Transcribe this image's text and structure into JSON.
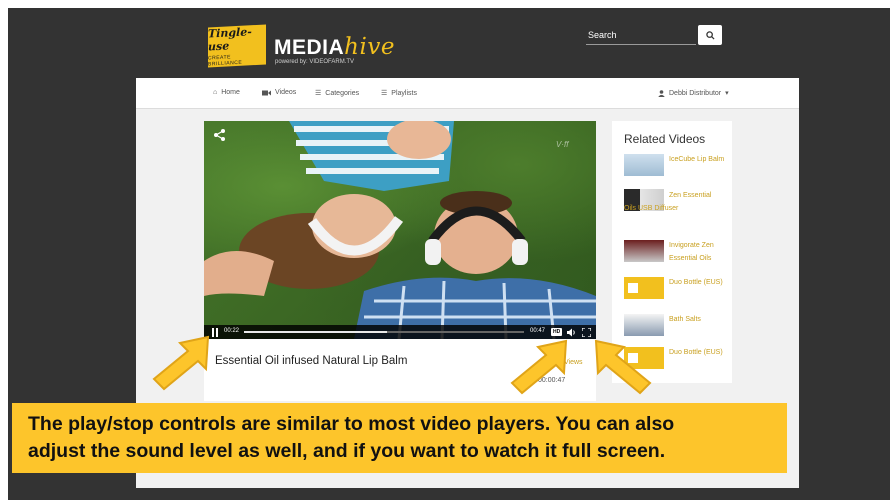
{
  "header": {
    "brand_badge_text": "Tingle-use",
    "brand_badge_subtext": "CREATE BRILLIANCE",
    "brand_word_main": "MEDIA",
    "brand_word_accent": "hive",
    "brand_powered": "powered by: VIDEOFARM.TV",
    "search_label": "Search",
    "search_icon": "search-icon"
  },
  "nav": {
    "home": "Home",
    "videos": "Videos",
    "categories": "Categories",
    "playlists": "Playlists",
    "user": "Debbi Distributor",
    "user_caret": "▾"
  },
  "player": {
    "current_time": "00:22",
    "total_time": "00:47",
    "progress": 0.51,
    "hd_label": "HD",
    "watermark": "V·ff",
    "icons": [
      "share-icon",
      "pause-icon",
      "volume-icon",
      "fullscreen-icon"
    ]
  },
  "video_info": {
    "title": "Essential Oil infused Natural Lip Balm",
    "views": "Views",
    "duration": "00:00:47"
  },
  "related": {
    "title": "Related Videos",
    "items": [
      {
        "title": "IceCube Lip Balm"
      },
      {
        "title": "Zen Essential Oils USB Diffuser"
      },
      {
        "title": "Invigorate Zen Essential Oils"
      },
      {
        "title": "Duo Bottle (EUS)"
      },
      {
        "title": "Bath Salts"
      },
      {
        "title": "Duo Bottle (EUS)"
      }
    ]
  },
  "callout": {
    "line1": "The play/stop controls are similar to most video players. You can also",
    "line2": "adjust the sound level as well, and if you want to watch it full screen."
  },
  "colors": {
    "accent": "#fdc52b",
    "dark_bg": "#333333",
    "link_gold": "#c9a020"
  }
}
